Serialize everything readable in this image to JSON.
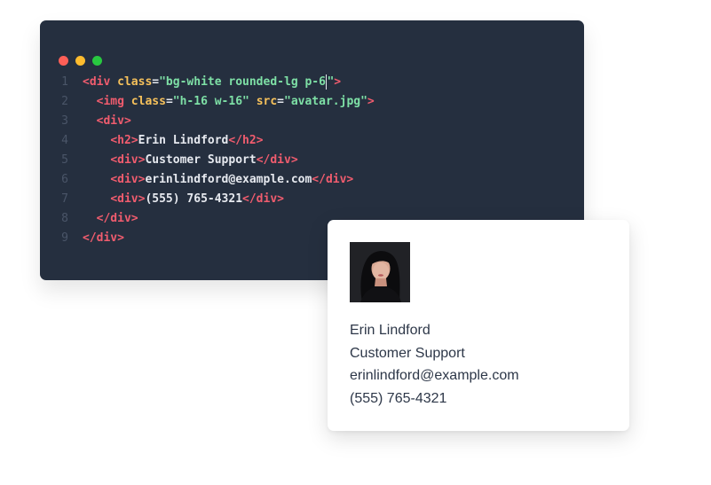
{
  "editor": {
    "window_controls": [
      {
        "name": "close",
        "color": "#ff5f57"
      },
      {
        "name": "minimize",
        "color": "#febc2e"
      },
      {
        "name": "maximize",
        "color": "#28c840"
      }
    ],
    "lines": [
      {
        "number": "1",
        "tokens": [
          {
            "t": "<",
            "c": "tag"
          },
          {
            "t": "div",
            "c": "tag"
          },
          {
            "t": " ",
            "c": "txt"
          },
          {
            "t": "class",
            "c": "attr"
          },
          {
            "t": "=",
            "c": "punc"
          },
          {
            "t": "\"bg-white rounded-lg p-6",
            "c": "str"
          },
          {
            "t": "|cursor|",
            "c": "cursor"
          },
          {
            "t": "\"",
            "c": "str"
          },
          {
            "t": ">",
            "c": "tag"
          }
        ]
      },
      {
        "number": "2",
        "tokens": [
          {
            "t": "  ",
            "c": "txt"
          },
          {
            "t": "<img",
            "c": "tag"
          },
          {
            "t": " ",
            "c": "txt"
          },
          {
            "t": "class",
            "c": "attr"
          },
          {
            "t": "=",
            "c": "punc"
          },
          {
            "t": "\"h-16 w-16\"",
            "c": "str"
          },
          {
            "t": " ",
            "c": "txt"
          },
          {
            "t": "src",
            "c": "attr"
          },
          {
            "t": "=",
            "c": "punc"
          },
          {
            "t": "\"avatar.jpg\"",
            "c": "str"
          },
          {
            "t": ">",
            "c": "tag"
          }
        ]
      },
      {
        "number": "3",
        "tokens": [
          {
            "t": "  ",
            "c": "txt"
          },
          {
            "t": "<div>",
            "c": "tag"
          }
        ]
      },
      {
        "number": "4",
        "tokens": [
          {
            "t": "    ",
            "c": "txt"
          },
          {
            "t": "<h2>",
            "c": "tag"
          },
          {
            "t": "Erin Lindford",
            "c": "txt"
          },
          {
            "t": "</h2>",
            "c": "tag"
          }
        ]
      },
      {
        "number": "5",
        "tokens": [
          {
            "t": "    ",
            "c": "txt"
          },
          {
            "t": "<div>",
            "c": "tag"
          },
          {
            "t": "Customer Support",
            "c": "txt"
          },
          {
            "t": "</div>",
            "c": "tag"
          }
        ]
      },
      {
        "number": "6",
        "tokens": [
          {
            "t": "    ",
            "c": "txt"
          },
          {
            "t": "<div>",
            "c": "tag"
          },
          {
            "t": "erinlindford@example.com",
            "c": "txt"
          },
          {
            "t": "</div>",
            "c": "tag"
          }
        ]
      },
      {
        "number": "7",
        "tokens": [
          {
            "t": "    ",
            "c": "txt"
          },
          {
            "t": "<div>",
            "c": "tag"
          },
          {
            "t": "(555) 765-4321",
            "c": "txt"
          },
          {
            "t": "</div>",
            "c": "tag"
          }
        ]
      },
      {
        "number": "8",
        "tokens": [
          {
            "t": "  ",
            "c": "txt"
          },
          {
            "t": "</div>",
            "c": "tag"
          }
        ]
      },
      {
        "number": "9",
        "tokens": [
          {
            "t": "</div>",
            "c": "tag"
          }
        ]
      }
    ]
  },
  "card": {
    "avatar_icon": "avatar-photo",
    "name": "Erin Lindford",
    "role": "Customer Support",
    "email": "erinlindford@example.com",
    "phone": "(555) 765-4321"
  }
}
